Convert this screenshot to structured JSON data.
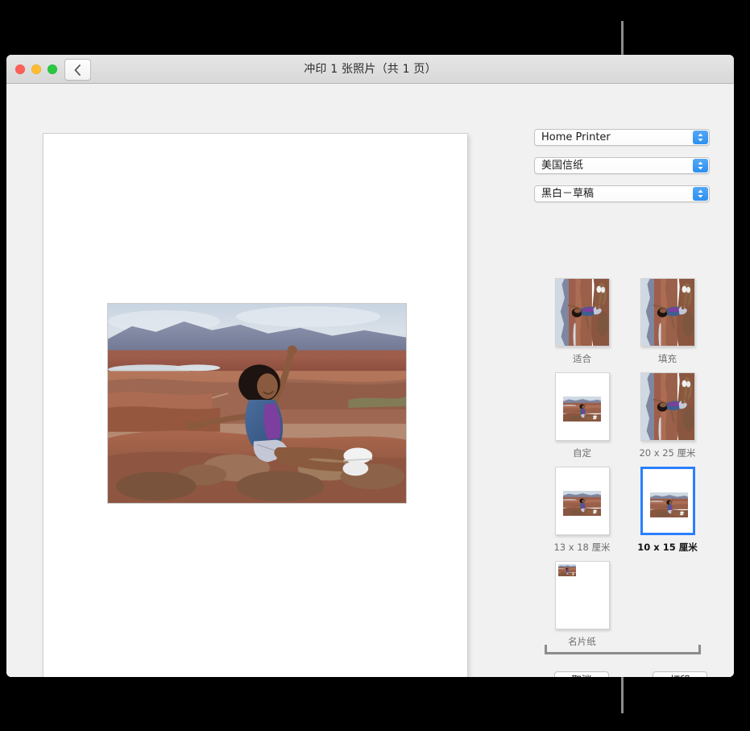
{
  "window": {
    "title": "冲印 1 张照片（共 1 页）",
    "traffic_lights": {
      "close": "close-button",
      "minimize": "minimize-button",
      "zoom": "zoom-button"
    },
    "back_button_icon": "chevron-left-icon"
  },
  "preview": {
    "paper_description": "打印预览页面",
    "photo_description": "女子坐在峡谷边缘举起双臂的照片"
  },
  "options": {
    "printer": {
      "label": "Home Printer",
      "icon": "stepper-up-down-icon"
    },
    "paper_size": {
      "label": "美国信纸",
      "icon": "stepper-up-down-icon"
    },
    "preset": {
      "label": "黑白－草稿",
      "icon": "stepper-up-down-icon"
    }
  },
  "layouts": {
    "rows": [
      [
        {
          "id": "fit",
          "label": "适合",
          "selected": false,
          "style": "rotated-full"
        },
        {
          "id": "fill",
          "label": "填充",
          "selected": false,
          "style": "rotated-full"
        }
      ],
      [
        {
          "id": "custom",
          "label": "自定",
          "selected": false,
          "style": "inset-medium"
        },
        {
          "id": "20x25",
          "label": "20 x 25 厘米",
          "selected": false,
          "style": "rotated-full"
        }
      ],
      [
        {
          "id": "13x18",
          "label": "13 x 18 厘米",
          "selected": false,
          "style": "inset-medium"
        },
        {
          "id": "10x15",
          "label": "10 x 15 厘米",
          "selected": true,
          "style": "inset-medium"
        }
      ],
      [
        {
          "id": "business",
          "label": "名片纸",
          "selected": false,
          "style": "inset-tiny"
        }
      ]
    ]
  },
  "buttons": {
    "cancel": "取消",
    "print": "打印"
  },
  "annotations": {
    "callout_top": "callout-line-top",
    "callout_bottom": "callout-line-bottom",
    "bracket": "bracket-underline"
  },
  "colors": {
    "accent_blue": "#2a7fff",
    "stepper_blue": "#2c8ff0",
    "window_bg": "#f1f1f1",
    "titlebar": "#e0e0e0",
    "callout_gray": "#8c8c8c",
    "traffic_red": "#ff5f57",
    "traffic_yellow": "#febc2e",
    "traffic_green": "#28c840"
  }
}
